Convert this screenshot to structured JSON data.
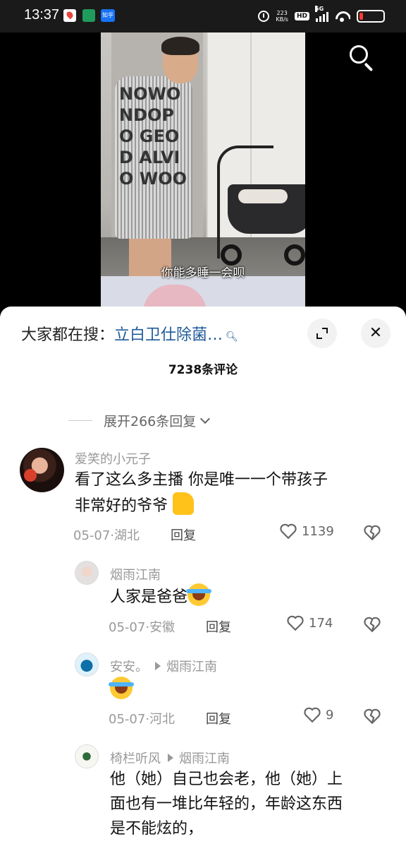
{
  "status_bar": {
    "time": "13:37",
    "zhihu_label": "知乎",
    "net_speed_value": "223",
    "net_speed_unit": "KB/s",
    "hd_badge": "HD",
    "signal_label": "5G",
    "battery_level_percent": 15,
    "battery_color": "#ff3b30"
  },
  "video": {
    "subtitle": "你能多睡一会呗",
    "search_icon": "search-icon"
  },
  "comment_panel": {
    "search_prefix": "大家都在搜：",
    "search_term": "立白卫仕除菌…",
    "comment_count": "7238条评论",
    "expand_replies": "展开266条回复",
    "link_color": "#1e5a99"
  },
  "comments": [
    {
      "username": "爱笑的小元子",
      "text_line1": "看了这么多主播 你是唯一一个带孩子",
      "text_line2": "非常好的爷爷",
      "emoji": "thumbs-up-emoji",
      "date": "05-07",
      "location": "湖北",
      "reply_label": "回复",
      "likes": "1139"
    },
    {
      "username": "烟雨江南",
      "text": "人家是爸爸",
      "emoji": "laughing-crying-emoji",
      "date": "05-07",
      "location": "安徽",
      "reply_label": "回复",
      "likes": "174"
    },
    {
      "username": "安安。",
      "reply_to": "烟雨江南",
      "emoji": "laughing-crying-emoji",
      "date": "05-07",
      "location": "河北",
      "reply_label": "回复",
      "likes": "9"
    },
    {
      "username": "椅栏听风",
      "reply_to": "烟雨江南",
      "text_line1": "他（她）自己也会老，他（她）上",
      "text_line2": "面也有一堆比年轻的，年龄这东西",
      "text_line3": "是不能炫的，"
    }
  ]
}
